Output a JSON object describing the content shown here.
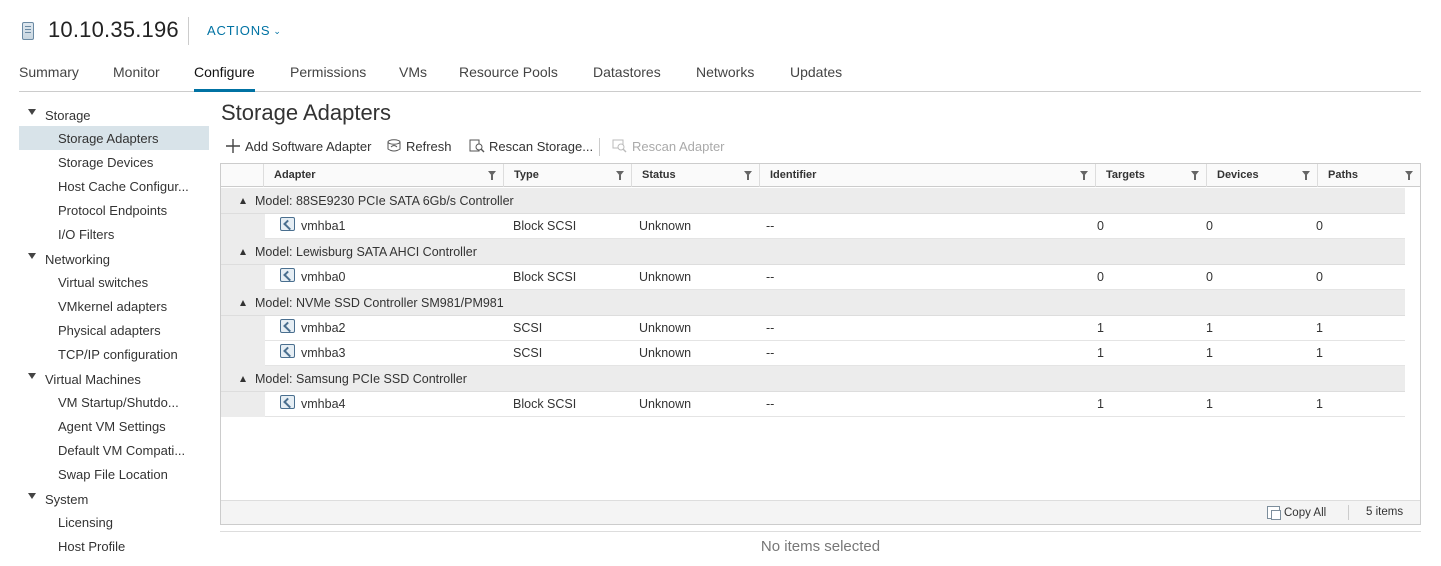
{
  "header": {
    "host_title": "10.10.35.196",
    "actions_label": "ACTIONS",
    "host_icon": "host-server-icon"
  },
  "tabs": [
    {
      "label": "Summary",
      "active": false
    },
    {
      "label": "Monitor",
      "active": false
    },
    {
      "label": "Configure",
      "active": true
    },
    {
      "label": "Permissions",
      "active": false
    },
    {
      "label": "VMs",
      "active": false
    },
    {
      "label": "Resource Pools",
      "active": false
    },
    {
      "label": "Datastores",
      "active": false
    },
    {
      "label": "Networks",
      "active": false
    },
    {
      "label": "Updates",
      "active": false
    }
  ],
  "sidebar": {
    "groups": [
      {
        "label": "Storage",
        "items": [
          "Storage Adapters",
          "Storage Devices",
          "Host Cache Configur...",
          "Protocol Endpoints",
          "I/O Filters"
        ]
      },
      {
        "label": "Networking",
        "items": [
          "Virtual switches",
          "VMkernel adapters",
          "Physical adapters",
          "TCP/IP configuration"
        ]
      },
      {
        "label": "Virtual Machines",
        "items": [
          "VM Startup/Shutdo...",
          "Agent VM Settings",
          "Default VM Compati...",
          "Swap File Location"
        ]
      },
      {
        "label": "System",
        "items": [
          "Licensing",
          "Host Profile"
        ]
      }
    ],
    "selected": "Storage Adapters"
  },
  "main": {
    "title": "Storage Adapters",
    "toolbar": {
      "add_software_adapter": "Add Software Adapter",
      "refresh": "Refresh",
      "rescan_storage": "Rescan Storage...",
      "rescan_adapter": "Rescan Adapter"
    },
    "columns": [
      "Adapter",
      "Type",
      "Status",
      "Identifier",
      "Targets",
      "Devices",
      "Paths"
    ],
    "groups": [
      {
        "label": "Model: 88SE9230 PCIe SATA 6Gb/s Controller",
        "rows": [
          {
            "adapter": "vmhba1",
            "type": "Block SCSI",
            "status": "Unknown",
            "identifier": "--",
            "targets": "0",
            "devices": "0",
            "paths": "0"
          }
        ]
      },
      {
        "label": "Model: Lewisburg SATA AHCI Controller",
        "rows": [
          {
            "adapter": "vmhba0",
            "type": "Block SCSI",
            "status": "Unknown",
            "identifier": "--",
            "targets": "0",
            "devices": "0",
            "paths": "0"
          }
        ]
      },
      {
        "label": "Model: NVMe SSD Controller SM981/PM981",
        "rows": [
          {
            "adapter": "vmhba2",
            "type": "SCSI",
            "status": "Unknown",
            "identifier": "--",
            "targets": "1",
            "devices": "1",
            "paths": "1"
          },
          {
            "adapter": "vmhba3",
            "type": "SCSI",
            "status": "Unknown",
            "identifier": "--",
            "targets": "1",
            "devices": "1",
            "paths": "1"
          }
        ]
      },
      {
        "label": "Model: Samsung PCIe SSD Controller",
        "rows": [
          {
            "adapter": "vmhba4",
            "type": "Block SCSI",
            "status": "Unknown",
            "identifier": "--",
            "targets": "1",
            "devices": "1",
            "paths": "1"
          }
        ]
      }
    ],
    "footer": {
      "copy_all": "Copy All",
      "item_count": "5 items"
    },
    "no_selection": "No items selected"
  },
  "colors": {
    "accent": "#0072a3",
    "selected_bg": "#d8e3e9",
    "group_row_bg": "#ececec"
  }
}
